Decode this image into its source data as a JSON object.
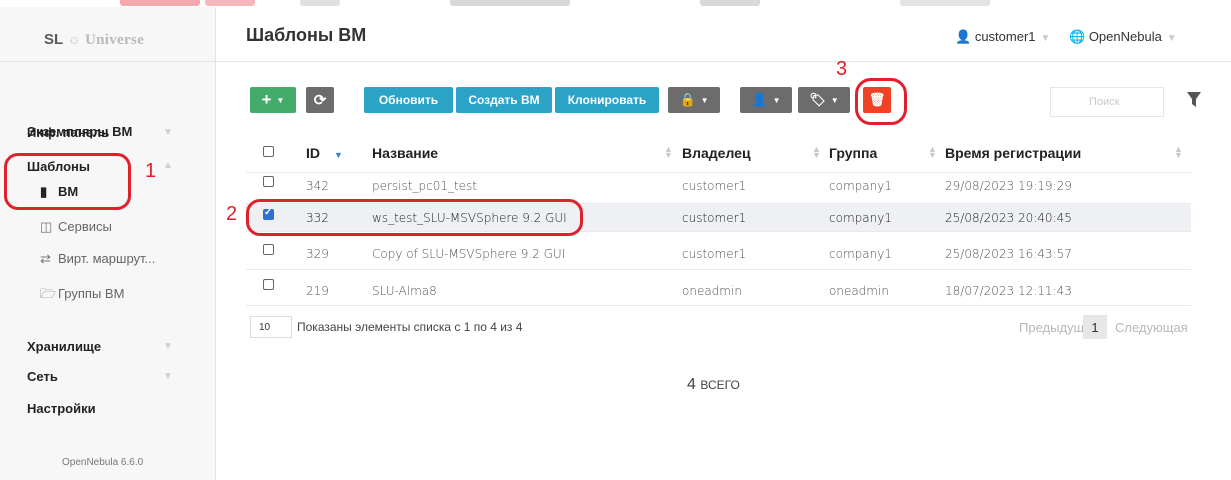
{
  "header": {
    "title": "Шаблоны ВМ",
    "user": "customer1",
    "cloud": "OpenNebula"
  },
  "brand": {
    "sl": "SL",
    "name": "Universe"
  },
  "sidebar": {
    "items": [
      {
        "label": "Инф. панель"
      },
      {
        "label": "Экземпляры ВМ"
      },
      {
        "label": "Шаблоны"
      },
      {
        "label": "ВМ"
      },
      {
        "label": "Сервисы"
      },
      {
        "label": "Вирт. маршрут..."
      },
      {
        "label": "Группы ВМ"
      },
      {
        "label": "Хранилище"
      },
      {
        "label": "Сеть"
      },
      {
        "label": "Настройки"
      }
    ],
    "version": "OpenNebula 6.6.0"
  },
  "toolbar": {
    "refresh_label": "Обновить",
    "create_vm_label": "Создать ВМ",
    "clone_label": "Клонировать",
    "search_placeholder": "Поиск"
  },
  "table": {
    "columns": [
      "ID",
      "Название",
      "Владелец",
      "Группа",
      "Время регистрации"
    ],
    "rows": [
      {
        "id": "342",
        "name": "persist_pc01_test",
        "owner": "customer1",
        "group": "company1",
        "time": "29/08/2023 19:19:29",
        "checked": false
      },
      {
        "id": "332",
        "name": "ws_test_SLU-MSVSphere 9.2 GUI",
        "owner": "customer1",
        "group": "company1",
        "time": "25/08/2023 20:40:45",
        "checked": true
      },
      {
        "id": "329",
        "name": "Copy of SLU-MSVSphere 9.2 GUI",
        "owner": "customer1",
        "group": "company1",
        "time": "25/08/2023 16:43:57",
        "checked": false
      },
      {
        "id": "219",
        "name": "SLU-Alma8",
        "owner": "oneadmin",
        "group": "oneadmin",
        "time": "18/07/2023 12:11:43",
        "checked": false
      }
    ]
  },
  "pagination": {
    "page_size": "10",
    "info": "Показаны элементы списка с 1 по 4 из 4",
    "prev": "Предыдущая",
    "current": "1",
    "next": "Следующая"
  },
  "summary": {
    "count": "4",
    "label": "ВСЕГО"
  },
  "annotations": {
    "one": "1",
    "two": "2",
    "three": "3"
  },
  "colors": {
    "green": "#43ac6a",
    "teal": "#2aa3c7",
    "gray": "#6c6c6c",
    "red": "#f04124",
    "annotation": "#e0202a"
  }
}
